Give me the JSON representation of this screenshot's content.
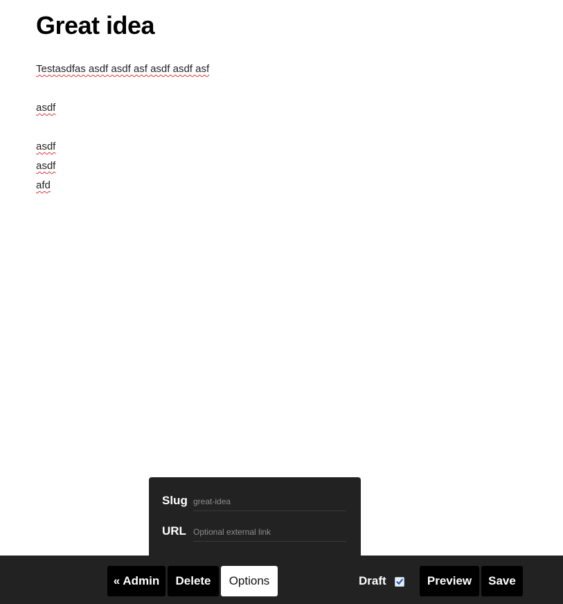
{
  "post": {
    "title": "Great idea",
    "body_lines": [
      "Testasdfas asdf asdf asf asdf asdf asf",
      "",
      "asdf",
      "",
      "asdf",
      "asdf",
      "afd"
    ]
  },
  "options_panel": {
    "slug_label": "Slug",
    "slug_placeholder": "great-idea",
    "url_label": "URL",
    "url_placeholder": "Optional external link"
  },
  "toolbar": {
    "admin_label": "« Admin",
    "delete_label": "Delete",
    "options_label": "Options",
    "draft_label": "Draft",
    "draft_checked": true,
    "preview_label": "Preview",
    "save_label": "Save"
  },
  "colors": {
    "toolbar_bg": "#222222",
    "button_bg": "#000000",
    "active_button_bg": "#ffffff",
    "checkmark": "#1e5fb3"
  },
  "icons": {
    "draft_checkbox": "checkmark-icon"
  }
}
